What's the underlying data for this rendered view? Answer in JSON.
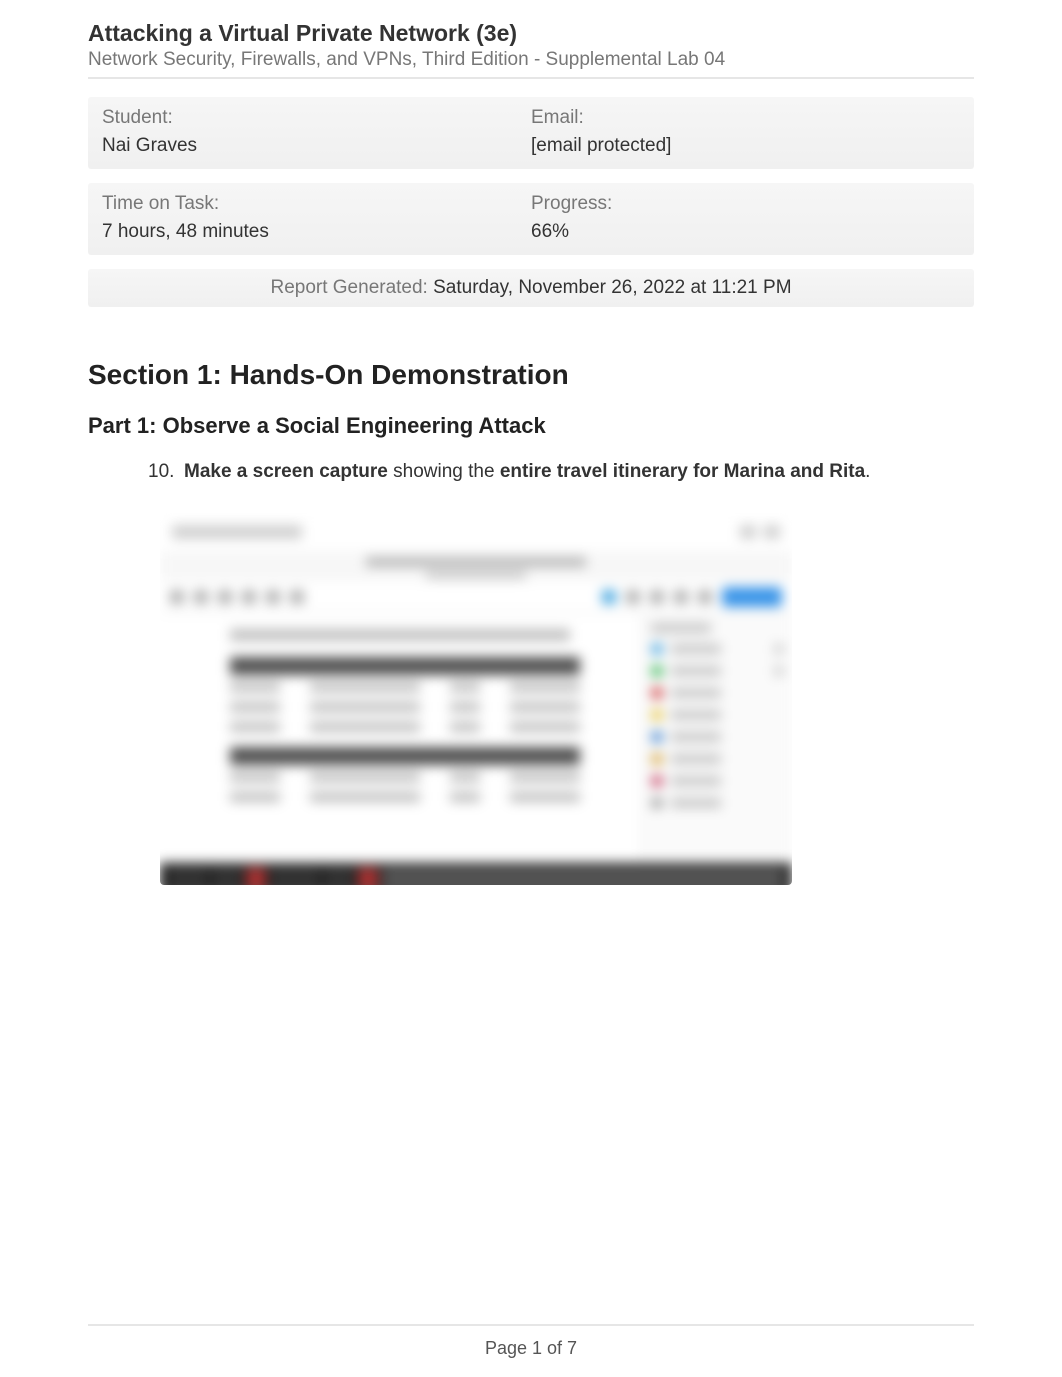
{
  "header": {
    "title": "Attacking a Virtual Private Network (3e)",
    "subtitle": "Network Security, Firewalls, and VPNs, Third Edition - Supplemental Lab 04"
  },
  "info": {
    "student_label": "Student:",
    "student_value": "Nai Graves",
    "email_label": "Email:",
    "email_value": "[email protected]",
    "time_label": "Time on Task:",
    "time_value": "7 hours, 48 minutes",
    "progress_label": "Progress:",
    "progress_value": "66%"
  },
  "report": {
    "label": "Report Generated: ",
    "value": "Saturday, November 26, 2022 at 11:21 PM"
  },
  "section": {
    "heading": "Section 1: Hands-On Demonstration",
    "part_heading": "Part 1: Observe a Social Engineering Attack"
  },
  "task": {
    "number": "10.",
    "bold1": "Make a screen capture",
    "mid": " showing the ",
    "bold2": "entire travel itinerary for Marina and Rita",
    "end": "."
  },
  "sidebar_colors": [
    "#4aa8e0",
    "#3cb85a",
    "#d14444",
    "#e8c84a",
    "#4a8ad1",
    "#d8a848",
    "#c84a6a",
    "#a0a0a0"
  ],
  "footer": {
    "page": "Page 1 of 7"
  }
}
